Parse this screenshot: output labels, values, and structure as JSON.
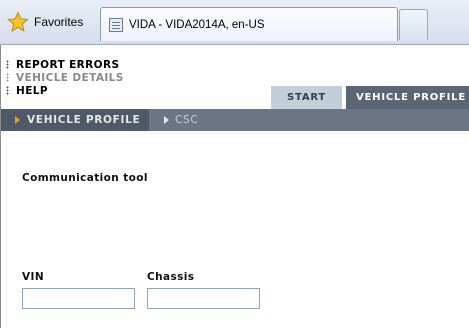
{
  "browser": {
    "favorites_label": "Favorites",
    "tab_title": "VIDA - VIDA2014A, en-US"
  },
  "top_menu": [
    {
      "label": "REPORT ERRORS",
      "state": "active"
    },
    {
      "label": "VEHICLE DETAILS",
      "state": "inactive"
    },
    {
      "label": "HELP",
      "state": "active"
    }
  ],
  "main_tabs": {
    "start": "START",
    "vehicle_profile": "VEHICLE PROFILE"
  },
  "sub_tabs": {
    "vehicle_profile": "VEHICLE PROFILE",
    "csc": "CSC"
  },
  "content": {
    "communication_tool_label": "Communication tool",
    "vin_label": "VIN",
    "vin_value": "",
    "chassis_label": "Chassis",
    "chassis_value": ""
  },
  "colors": {
    "main_tab_active": "#5b6675",
    "main_tab_inactive": "#c3cfd8",
    "subbar": "#6b7585",
    "subtab_active": "#4f5967",
    "accent_arrow": "#e7a21a"
  }
}
